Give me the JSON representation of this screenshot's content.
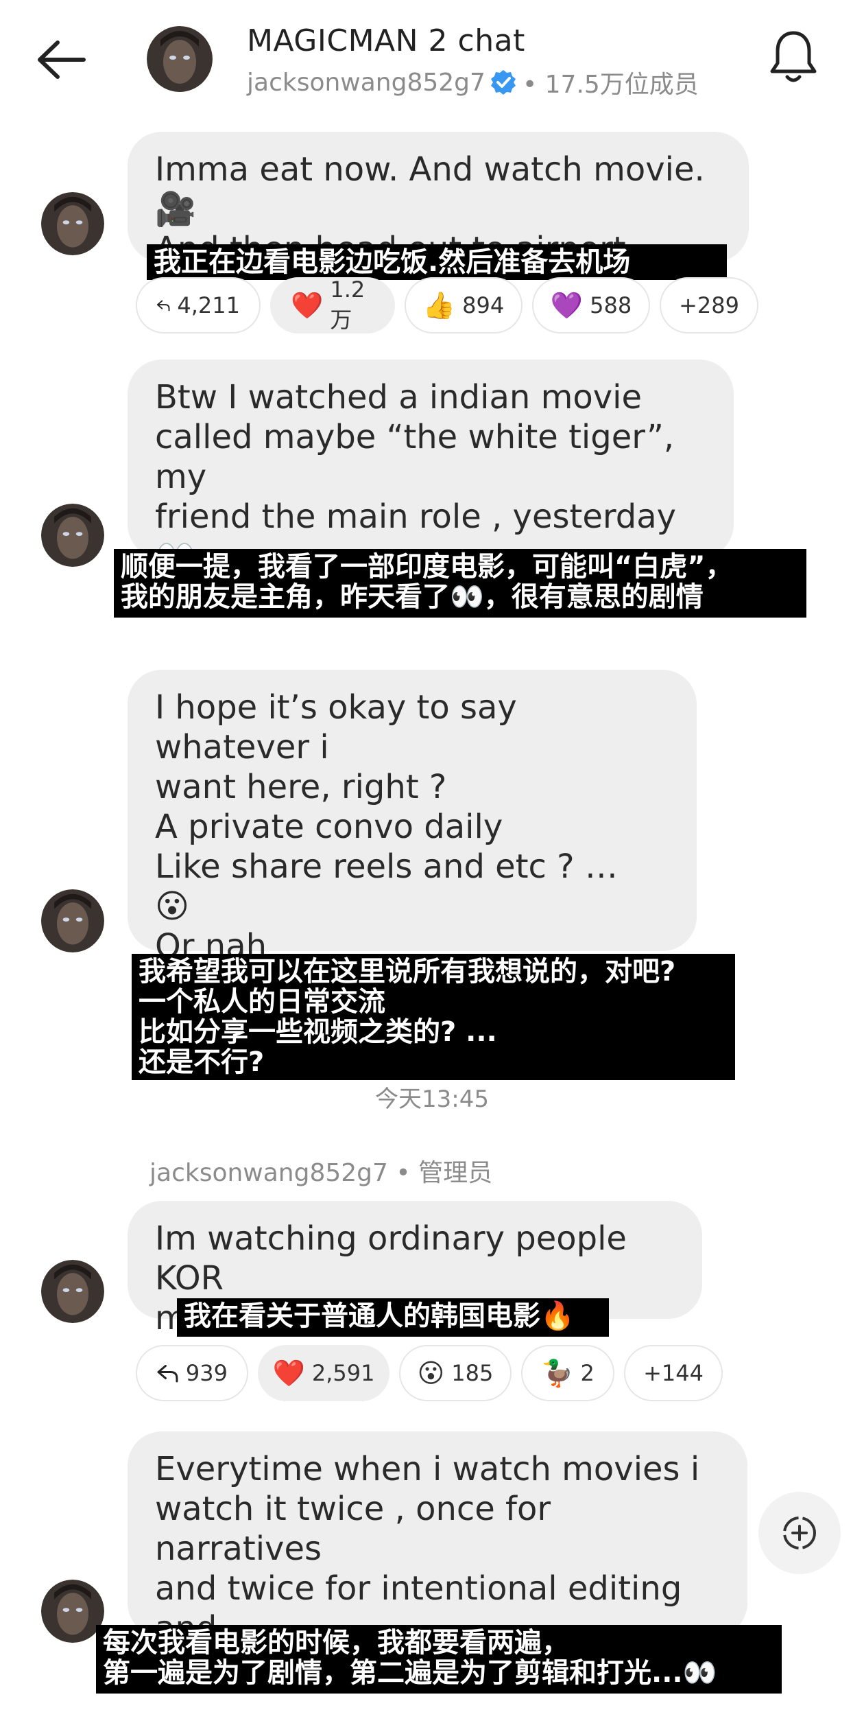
{
  "header": {
    "title": "MAGICMAN 2 chat",
    "owner": "jacksonwang852g7",
    "members": "• 17.5万位成员"
  },
  "messages": [
    {
      "text": "Imma eat now. And watch movie. 🎥\nAnd then head out to airport",
      "subtitle": "我正在边看电影边吃饭.然后准备去机场",
      "reactions": [
        {
          "icon": "reply-icon",
          "count": "4,211"
        },
        {
          "emoji": "❤️",
          "count": "1.2万"
        },
        {
          "emoji": "👍",
          "count": "894"
        },
        {
          "emoji": "💜",
          "count": "588"
        },
        {
          "count": "+289"
        }
      ]
    },
    {
      "text": "Btw I watched a indian movie\ncalled maybe “the white tiger”, my\nfriend the main role , yesterday 👀\ninteresting plot 🫡🔥",
      "subtitle": "顺便一提，我看了一部印度电影，可能叫“白虎”，\n我的朋友是主角，昨天看了👀，很有意思的剧情"
    },
    {
      "text": "I hope it’s okay to say whatever i\nwant here, right ?\nA private convo daily\nLike share reels and etc ? …\n😮\nOr nah",
      "subtitle": "我希望我可以在这里说所有我想说的，对吧?\n一个私人的日常交流\n比如分享一些视频之类的? ...\n还是不行?"
    },
    {
      "text": "Im watching ordinary people KOR\nmovie 🔥",
      "subtitle": "我在看关于普通人的韩国电影🔥",
      "reactions": [
        {
          "icon": "reply-icon",
          "count": "939"
        },
        {
          "emoji": "❤️",
          "count": "2,591"
        },
        {
          "emoji": "😮",
          "count": "185"
        },
        {
          "emoji": "🦆",
          "count": "2"
        },
        {
          "count": "+144"
        }
      ]
    },
    {
      "text": "Everytime when i watch movies i\nwatch it twice , once for narratives\nand twice for intentional editing and\nlighting… 👀",
      "subtitle": "每次我看电影的时候，我都要看两遍，\n第一遍是为了剧情，第二遍是为了剪辑和打光...👀"
    }
  ],
  "timestamp": "今天13:45",
  "sender": "jacksonwang852g7 • 管理员",
  "colors": {
    "bubble": "#eeeeee",
    "verified": "#3897f0",
    "subtitle_bg": "#000000",
    "muted": "#8b8b8b"
  }
}
